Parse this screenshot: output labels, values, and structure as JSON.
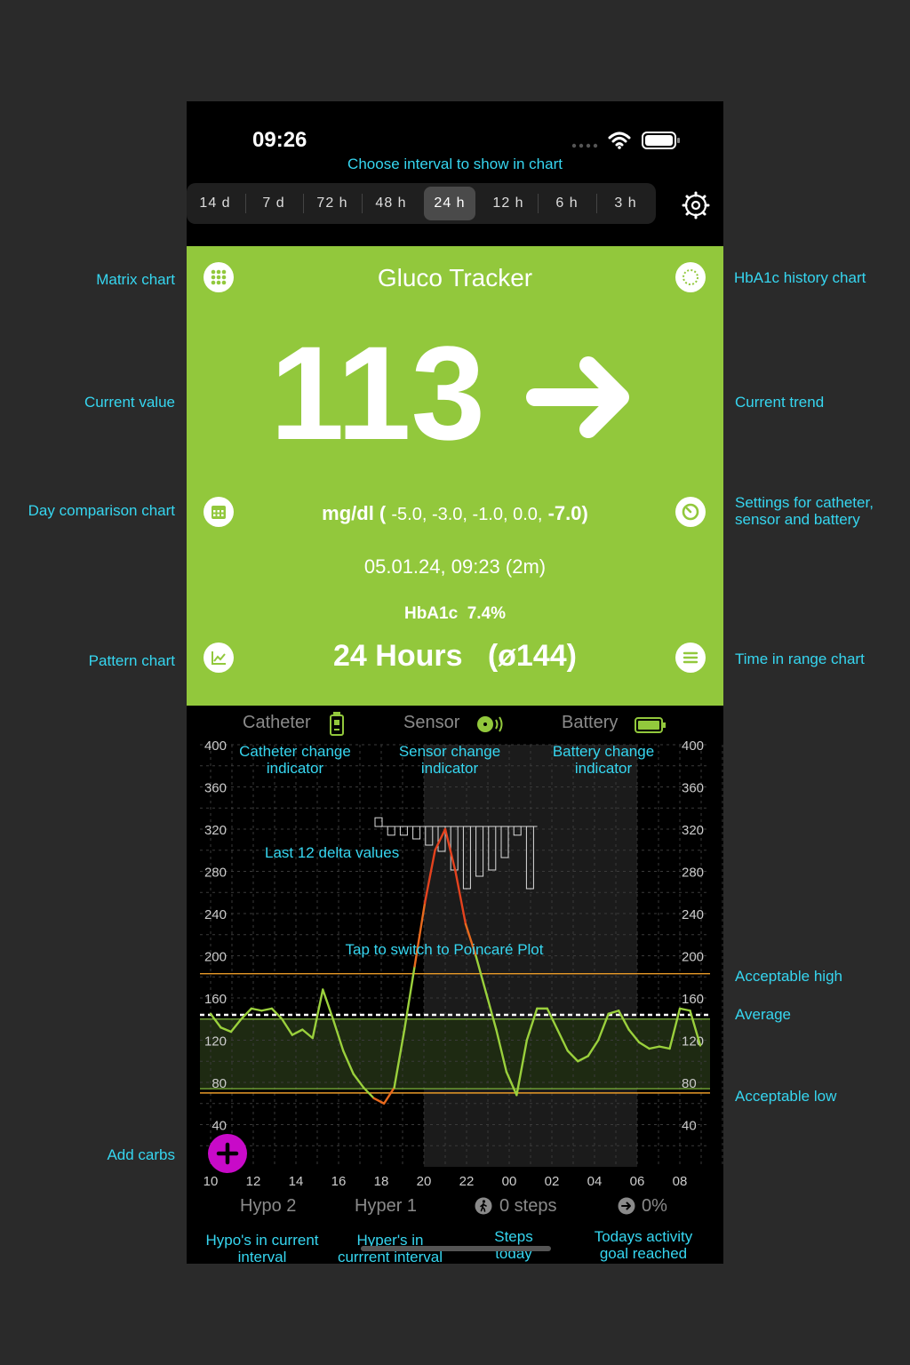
{
  "status_bar": {
    "time": "09:26"
  },
  "interval_bar": {
    "hint": "Choose interval to show in chart",
    "options": [
      "14 d",
      "7 d",
      "72 h",
      "48 h",
      "24 h",
      "12 h",
      "6 h",
      "3 h"
    ],
    "selected": "24 h"
  },
  "header": {
    "title": "Gluco Tracker"
  },
  "reading": {
    "value": "113",
    "unit": "mg/dl (",
    "deltas": "-5.0, -3.0, -1.0, 0.0,",
    "last_delta": "-7.0)",
    "timestamp": "05.01.24, 09:23 (2m)",
    "hba1c_label": "HbA1c",
    "hba1c_value": "7.4%",
    "interval_label": "24 Hours",
    "average": "(ø144)"
  },
  "device_status": {
    "catheter": "Catheter",
    "sensor": "Sensor",
    "battery": "Battery"
  },
  "stats": {
    "hypo": "Hypo 2",
    "hyper": "Hyper 1",
    "steps": "0 steps",
    "activity": "0%"
  },
  "annotations": {
    "matrix_chart": "Matrix chart",
    "hba1c_history": "HbA1c history chart",
    "current_value": "Current value",
    "current_trend": "Current trend",
    "day_comparison": "Day comparison chart",
    "settings_line1": "Settings for catheter,",
    "settings_line2": "sensor and battery",
    "pattern_chart": "Pattern chart",
    "time_in_range": "Time in range chart",
    "catheter_change_1": "Catheter change",
    "catheter_change_2": "indicator",
    "sensor_change_1": "Sensor change",
    "sensor_change_2": "indicator",
    "battery_change_1": "Battery change",
    "battery_change_2": "indicator",
    "last_12_delta": "Last 12 delta values",
    "tap_poincare": "Tap to switch to Poincaré Plot",
    "acceptable_high": "Acceptable high",
    "average": "Average",
    "acceptable_low": "Acceptable low",
    "add_carbs": "Add carbs",
    "hypos_1": "Hypo's in current",
    "hypos_2": "interval",
    "hypers_1": "Hyper's in",
    "hypers_2": "currrent interval",
    "steps_1": "Steps",
    "steps_2": "today",
    "activity_1": "Todays activity",
    "activity_2": "goal reached"
  },
  "chart_data": {
    "type": "line",
    "ylim": [
      40,
      400
    ],
    "y_ticks": [
      400,
      360,
      320,
      280,
      240,
      200,
      160,
      120,
      80,
      40
    ],
    "x_ticks": [
      "10",
      "12",
      "14",
      "16",
      "18",
      "20",
      "22",
      "00",
      "02",
      "04",
      "06",
      "08"
    ],
    "acceptable_high": 183,
    "acceptable_low": 70,
    "average": 144,
    "target_band": [
      74,
      140
    ],
    "series": [
      {
        "x_hours": [
          0,
          0.5,
          1,
          1.5,
          2,
          2.5,
          3,
          3.5,
          4,
          4.5,
          5,
          5.5,
          6,
          6.5,
          7,
          7.5,
          8,
          8.5,
          9,
          9.5,
          10,
          10.5,
          11,
          11.5,
          12,
          12.5,
          13,
          13.5,
          14,
          14.5,
          15,
          15.5,
          16,
          16.5,
          17,
          17.5,
          18,
          18.5,
          19,
          19.5,
          20,
          20.5,
          21,
          21.5,
          22,
          22.5,
          23,
          23.5,
          24
        ],
        "values": [
          145,
          132,
          128,
          140,
          150,
          148,
          150,
          140,
          125,
          130,
          122,
          168,
          140,
          110,
          88,
          75,
          65,
          60,
          75,
          130,
          190,
          250,
          300,
          320,
          280,
          230,
          200,
          165,
          130,
          90,
          68,
          120,
          150,
          150,
          130,
          110,
          100,
          105,
          120,
          145,
          148,
          130,
          118,
          112,
          114,
          112,
          150,
          148,
          115
        ]
      }
    ],
    "delta_bars": [
      7,
      -7,
      -7,
      -10,
      -15,
      -20,
      -35,
      -50,
      -40,
      -35,
      -25,
      -7,
      -50
    ]
  }
}
